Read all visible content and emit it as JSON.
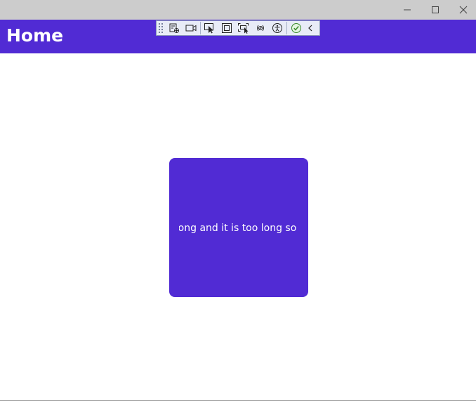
{
  "window": {
    "caption_buttons": [
      "minimize-icon",
      "maximize-icon",
      "close-icon"
    ]
  },
  "header": {
    "title": "Home",
    "color": "#512bd4"
  },
  "debug_toolbar": {
    "icons": [
      "live-visual-tree-icon",
      "record-icon",
      "select-element-icon",
      "display-layout-adorners-icon",
      "track-focused-element-icon",
      "binding-failures-icon",
      "accessibility-checker-icon",
      "scan-status-ok-icon",
      "collapse-chevron-icon"
    ]
  },
  "card": {
    "text": "This text is long and it is too long so I sure hope it wraps",
    "color": "#512bd4"
  }
}
